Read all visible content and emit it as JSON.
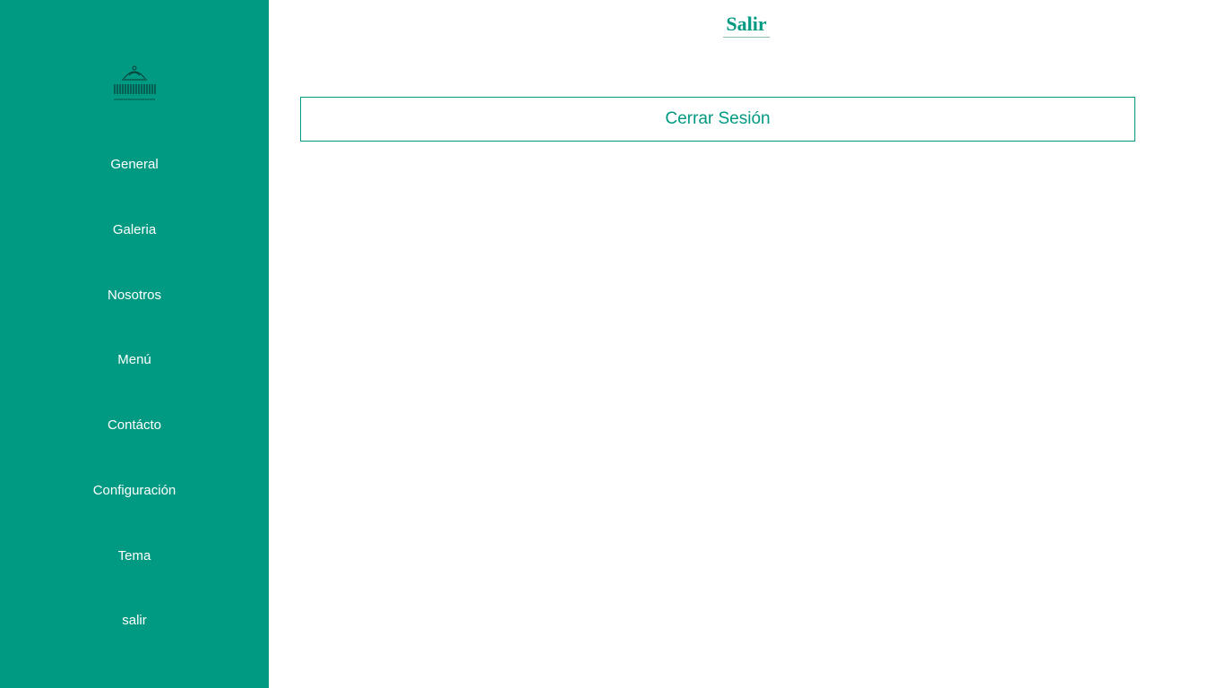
{
  "sidebar": {
    "logo_icon": "restaurant-logo-icon",
    "items": [
      {
        "label": "General"
      },
      {
        "label": "Galeria"
      },
      {
        "label": "Nosotros"
      },
      {
        "label": "Menú"
      },
      {
        "label": "Contácto"
      },
      {
        "label": "Configuración"
      },
      {
        "label": "Tema"
      },
      {
        "label": "salir"
      }
    ]
  },
  "main": {
    "title": "Salir",
    "logout_label": "Cerrar Sesión"
  },
  "colors": {
    "accent": "#009982",
    "background": "#ffffff",
    "sidebar_text": "#ffffff"
  }
}
